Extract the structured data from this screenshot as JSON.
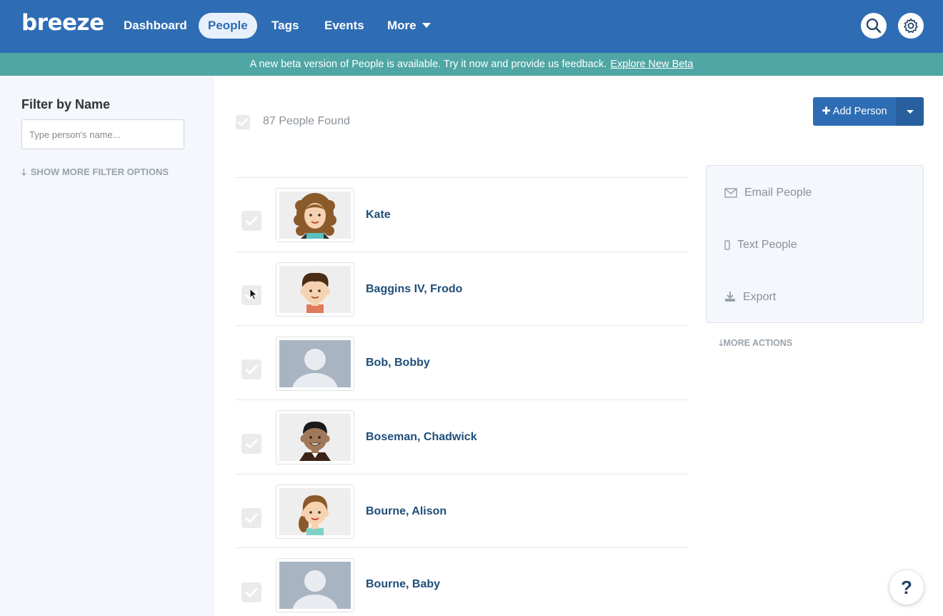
{
  "header": {
    "logo": "breeze",
    "nav": [
      "Dashboard",
      "People",
      "Tags",
      "Events",
      "More"
    ],
    "active": "People"
  },
  "banner": {
    "message": "A new beta version of People is available. Try it now and provide us feedback.",
    "link": "Explore New Beta"
  },
  "sidebar": {
    "title": "Filter by Name",
    "placeholder": "Type person's name...",
    "show_more": "SHOW MORE FILTER OPTIONS"
  },
  "main": {
    "found": "87 People Found",
    "add_person": "Add Person",
    "people": [
      {
        "name": "Kate",
        "avatar": "woman-curly"
      },
      {
        "name": "Baggins IV, Frodo",
        "avatar": "boy-brown-hair"
      },
      {
        "name": "Bob, Bobby",
        "avatar": "placeholder"
      },
      {
        "name": "Boseman, Chadwick",
        "avatar": "man-suit"
      },
      {
        "name": "Bourne, Alison",
        "avatar": "woman-ponytail"
      },
      {
        "name": "Bourne, Baby",
        "avatar": "placeholder"
      }
    ]
  },
  "actions": {
    "email": "Email People",
    "text": "Text People",
    "export": "Export",
    "more": "MORE ACTIONS"
  },
  "help": "?",
  "colors": {
    "nav": "#2e6db4",
    "banner": "#4fa6a4",
    "name_link": "#1f4e79"
  }
}
